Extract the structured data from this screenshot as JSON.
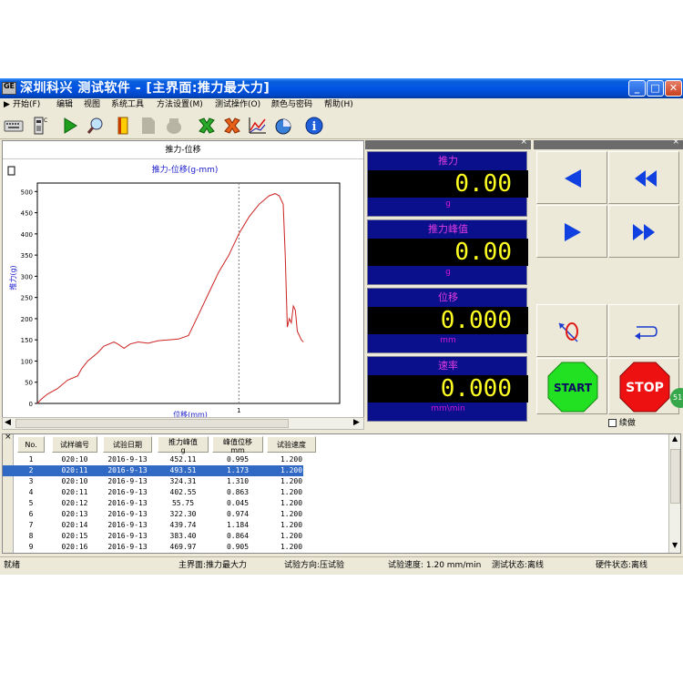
{
  "window": {
    "logo": "GE",
    "title": "深圳科兴  测试软件 - [主界面:推力最大力]"
  },
  "menu": [
    "开始(F)",
    "编辑",
    "视图",
    "系统工具",
    "方法设置(M)",
    "测试操作(O)",
    "颜色与密码",
    "帮助(H)"
  ],
  "toolbar_icons": [
    "keyboard-icon",
    "printer-icon",
    "play-icon",
    "magnifier-icon",
    "book-icon",
    "file-disabled-icon",
    "hand-disabled-icon",
    "green-x-icon",
    "orange-x-icon",
    "chart-icon",
    "pie-chart-icon",
    "info-icon"
  ],
  "chart_panel": {
    "tab_label": "推力-位移"
  },
  "chart_data": {
    "type": "line",
    "title": "推力-位移(g-mm)",
    "xlabel": "位移(mm)",
    "ylabel": "推力(g)",
    "xlim": [
      0,
      1.5
    ],
    "ylim": [
      0,
      520
    ],
    "yticks": [
      0,
      50,
      100,
      150,
      200,
      250,
      300,
      350,
      400,
      450,
      500
    ],
    "xticks": [
      1
    ],
    "gridline_x": 1,
    "series": [
      {
        "x": [
          0,
          0.02,
          0.05,
          0.1,
          0.15,
          0.2,
          0.22,
          0.25,
          0.3,
          0.33,
          0.38,
          0.4,
          0.43,
          0.46,
          0.5,
          0.55,
          0.6,
          0.65,
          0.7,
          0.75,
          0.8,
          0.85,
          0.9,
          0.95,
          1.0,
          1.05,
          1.1,
          1.15,
          1.18,
          1.2,
          1.22,
          1.23,
          1.24,
          1.25,
          1.26,
          1.27,
          1.28,
          1.29,
          1.3,
          1.31,
          1.32
        ],
        "y": [
          0,
          10,
          22,
          35,
          55,
          65,
          82,
          100,
          120,
          135,
          145,
          140,
          130,
          140,
          145,
          142,
          148,
          150,
          152,
          160,
          210,
          260,
          310,
          350,
          400,
          440,
          470,
          490,
          495,
          490,
          470,
          350,
          180,
          200,
          190,
          230,
          220,
          170,
          160,
          150,
          145
        ]
      }
    ]
  },
  "readouts": [
    {
      "label": "推力",
      "value": "0.00",
      "unit": "g"
    },
    {
      "label": "推力峰值",
      "value": "0.00",
      "unit": "g"
    },
    {
      "label": "位移",
      "value": "0.000",
      "unit": "mm"
    },
    {
      "label": "速率",
      "value": "0.000",
      "unit": "mm\\min"
    }
  ],
  "controls": {
    "start": "START",
    "stop": "STOP",
    "continue_label": "续做",
    "badge": "51"
  },
  "table": {
    "columns": [
      "No.",
      "试样编号",
      "试验日期",
      "推力峰值\ng",
      "峰值位移\nmm",
      "试验速度"
    ],
    "rows": [
      [
        "1",
        "020:10",
        "2016-9-13",
        "452.11",
        "0.995",
        "1.200"
      ],
      [
        "2",
        "020:11",
        "2016-9-13",
        "493.51",
        "1.173",
        "1.200"
      ],
      [
        "3",
        "020:10",
        "2016-9-13",
        "324.31",
        "1.310",
        "1.200"
      ],
      [
        "4",
        "020:11",
        "2016-9-13",
        "402.55",
        "0.863",
        "1.200"
      ],
      [
        "5",
        "020:12",
        "2016-9-13",
        "55.75",
        "0.045",
        "1.200"
      ],
      [
        "6",
        "020:13",
        "2016-9-13",
        "322.30",
        "0.974",
        "1.200"
      ],
      [
        "7",
        "020:14",
        "2016-9-13",
        "439.74",
        "1.184",
        "1.200"
      ],
      [
        "8",
        "020:15",
        "2016-9-13",
        "383.40",
        "0.864",
        "1.200"
      ],
      [
        "9",
        "020:16",
        "2016-9-13",
        "469.97",
        "0.905",
        "1.200"
      ]
    ],
    "selected_row": 1
  },
  "statusbar": [
    "就绪",
    "主界面:推力最大力",
    "试验方向:压试验",
    "试验速度: 1.20 mm/min",
    "测试状态:离线",
    "硬件状态:离线"
  ]
}
